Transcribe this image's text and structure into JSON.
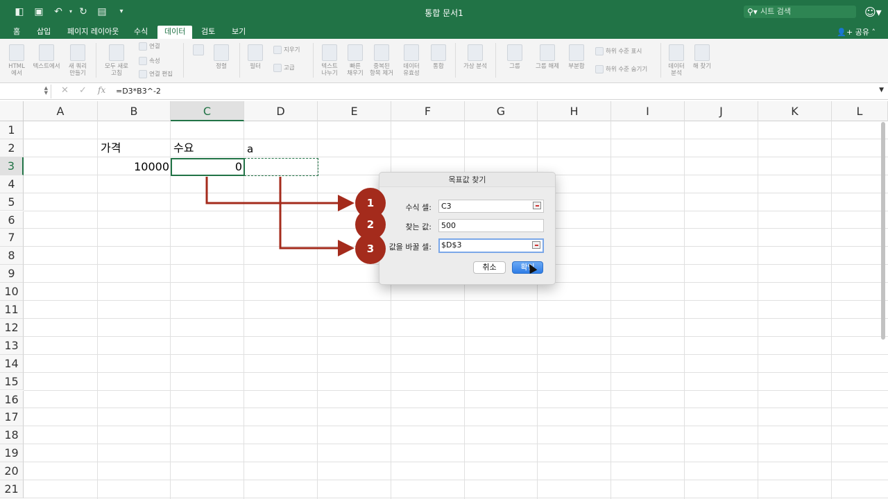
{
  "window": {
    "title": "통합 문서1"
  },
  "search": {
    "placeholder": "시트 검색"
  },
  "tabs": [
    {
      "label": "홈"
    },
    {
      "label": "삽입"
    },
    {
      "label": "페이지 레이아웃"
    },
    {
      "label": "수식"
    },
    {
      "label": "데이터"
    },
    {
      "label": "검토"
    },
    {
      "label": "보기"
    }
  ],
  "active_tab": "데이터",
  "share_label": "공유",
  "ribbon": {
    "html": "HTML\n에서",
    "text": "텍스트에서",
    "new_query": "새 쿼리\n만들기",
    "refresh_all": "모두 새로\n고침",
    "connections": "연결",
    "properties": "속성",
    "edit_links": "연결 편집",
    "sort": "정렬",
    "filter": "필터",
    "clear": "지우기",
    "advanced": "고급",
    "text_to_columns": "텍스트\n나누기",
    "flash_fill": "빠른\n채우기",
    "remove_duplicates": "중복된\n항목 제거",
    "data_validation": "데이터\n유효성",
    "consolidate": "통합",
    "what_if": "가상 분석",
    "group": "그룹",
    "ungroup": "그룹 해제",
    "subtotal": "부분합",
    "show_detail": "하위 수준 표시",
    "hide_detail": "하위 수준 숨기기",
    "data_analysis": "데이터\n분석",
    "solver": "해 찾기"
  },
  "formula_bar": {
    "name_box": "",
    "fx": "fx",
    "formula": "=D3*B3^-2"
  },
  "columns": [
    "A",
    "B",
    "C",
    "D",
    "E",
    "F",
    "G",
    "H",
    "I",
    "J",
    "K",
    "L"
  ],
  "rows": [
    "1",
    "2",
    "3",
    "4",
    "5",
    "6",
    "7",
    "8",
    "9",
    "10",
    "11",
    "12",
    "13",
    "14",
    "15",
    "16",
    "17",
    "18",
    "19",
    "20",
    "21"
  ],
  "cells": {
    "B2": "가격",
    "C2": "수요",
    "D2": "a",
    "B3": "10000",
    "C3": "0"
  },
  "dialog": {
    "title": "목표값 찾기",
    "set_cell_label": "수식 셀:",
    "set_cell_value": "C3",
    "to_value_label": "찾는 값:",
    "to_value_value": "500",
    "changing_cell_label": "값을 바꿀 셀:",
    "changing_cell_value": "$D$3",
    "cancel_label": "취소",
    "ok_label": "확인"
  },
  "annotations": {
    "badges": [
      "1",
      "2",
      "3"
    ],
    "color": "#a42b1c"
  },
  "colors": {
    "excel_green": "#217346",
    "annotation_red": "#a42b1c"
  }
}
